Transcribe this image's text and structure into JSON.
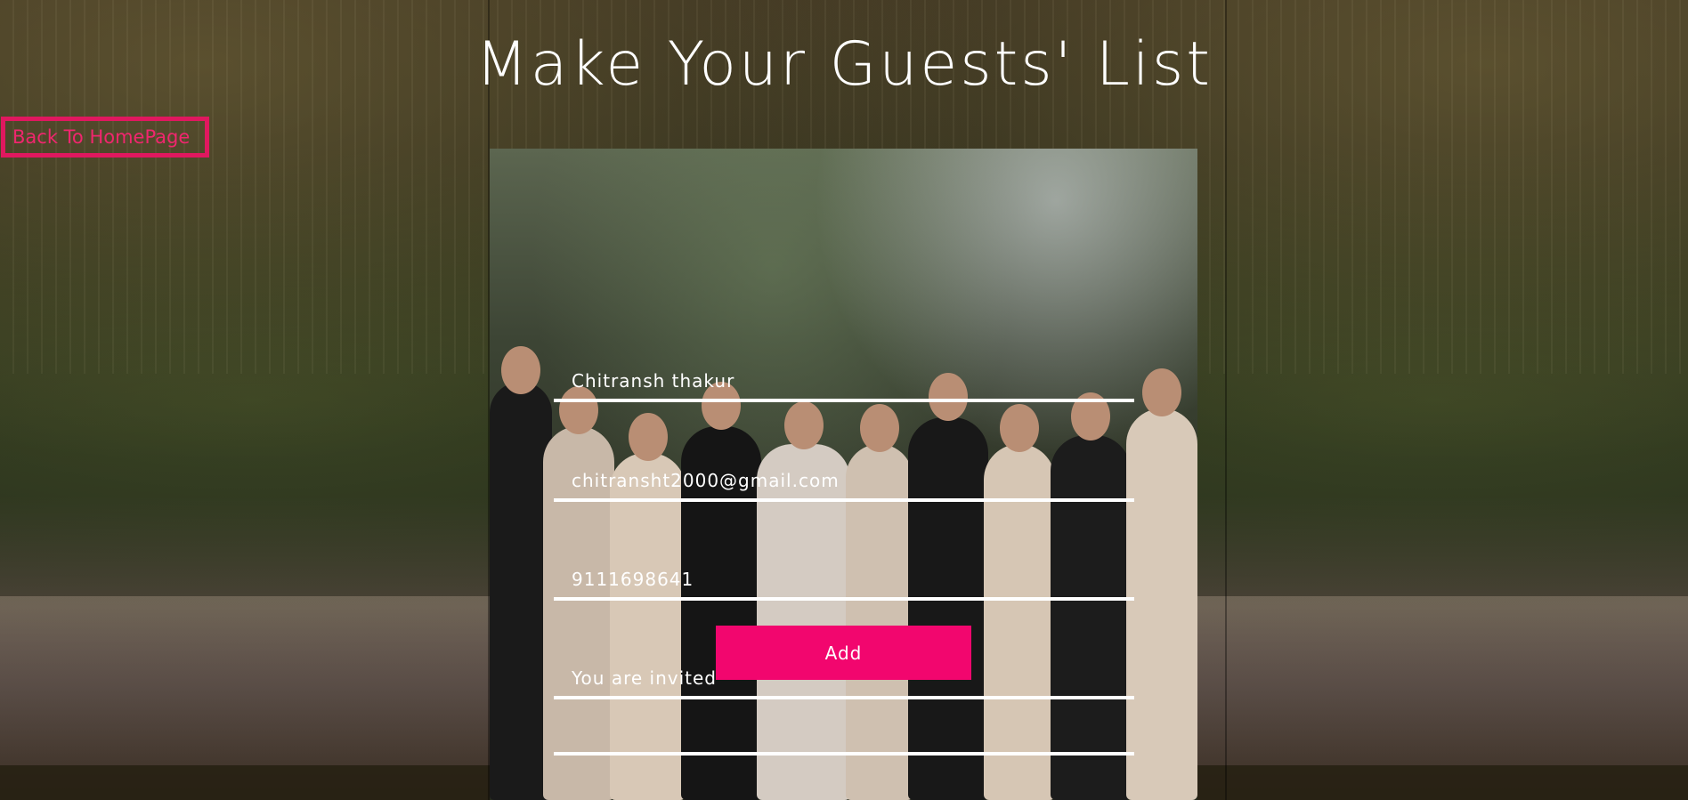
{
  "header": {
    "title": "Make Your Guests' List"
  },
  "nav": {
    "back_label": "Back To HomePage"
  },
  "form": {
    "name_value": "Chitransh thakur",
    "email_value": "chitransht2000@gmail.com",
    "phone_value": "9111698641",
    "message_value": "You are invited",
    "submit_label": "Add"
  },
  "colors": {
    "accent": "#f2066e",
    "back_border": "#e0185f",
    "field_text": "#ffffff"
  }
}
